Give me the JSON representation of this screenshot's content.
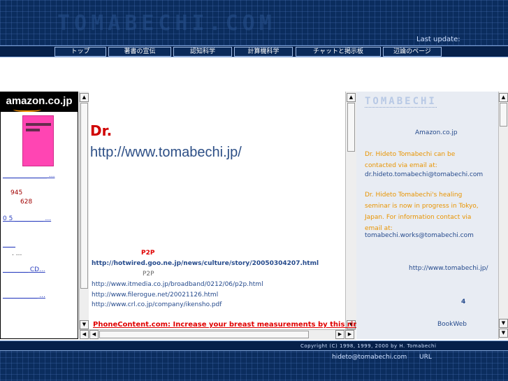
{
  "header": {
    "logo_text": "TOMABECHI.COM",
    "last_update": "Last update:"
  },
  "nav": {
    "items": [
      {
        "label": "トップ"
      },
      {
        "label": "著書の宣伝"
      },
      {
        "label": "認知科学"
      },
      {
        "label": "計算機科学"
      },
      {
        "label": "チャットと掲示板"
      },
      {
        "label": "辺論のページ"
      }
    ]
  },
  "left_panel": {
    "logo": "amazon.co.jp",
    "link1": "______________ ...",
    "price1": "945",
    "price2": "628",
    "link2": "0 5 _________ ...",
    "link3": "____",
    "text1": ". ...",
    "link4": "________ CD...",
    "link5": "___________ ..."
  },
  "main": {
    "title": "Dr.",
    "url": "http://www.tomabechi.jp/",
    "p2p_red": "P2P",
    "hotwired_link": "http://hotwired.goo.ne.jp/news/culture/story/20050304207.html",
    "p2p_gray": "P2P",
    "links": [
      "http://www.itmedia.co.jp/broadband/0212/06/p2p.html",
      "http://www.filerogue.net/20021126.html",
      "http://www.crl.co.jp/company/ikensho.pdf"
    ],
    "phonecontent": "PhoneContent.com: Increase your breast measurements by this ringtone"
  },
  "right_panel": {
    "logo_text": "TOMABECHI",
    "amazon": "Amazon.co.jp",
    "contact_text": "Dr. Hideto Tomabechi can be contacted via email at:",
    "contact_email": "dr.hideto.tomabechi@tomabechi.com",
    "seminar_text": "Dr. Hideto Tomabechi's healing seminar is now in progress in Tokyo, Japan. For information contact via email at:",
    "seminar_email": "tomabechi.works@tomabechi.com",
    "url": "http://www.tomabechi.jp/",
    "number": "4",
    "bookweb": "BookWeb"
  },
  "footer": {
    "copyright": "Copyright (C) 1998, 1999, 2000 by H. Tomabechi",
    "email": "hideto@tomabechi.com",
    "url_label": "URL"
  },
  "colors": {
    "header_bg": "#0b2d5e",
    "link_blue": "#254a8c",
    "accent_red": "#e00000",
    "accent_orange": "#e99400"
  }
}
